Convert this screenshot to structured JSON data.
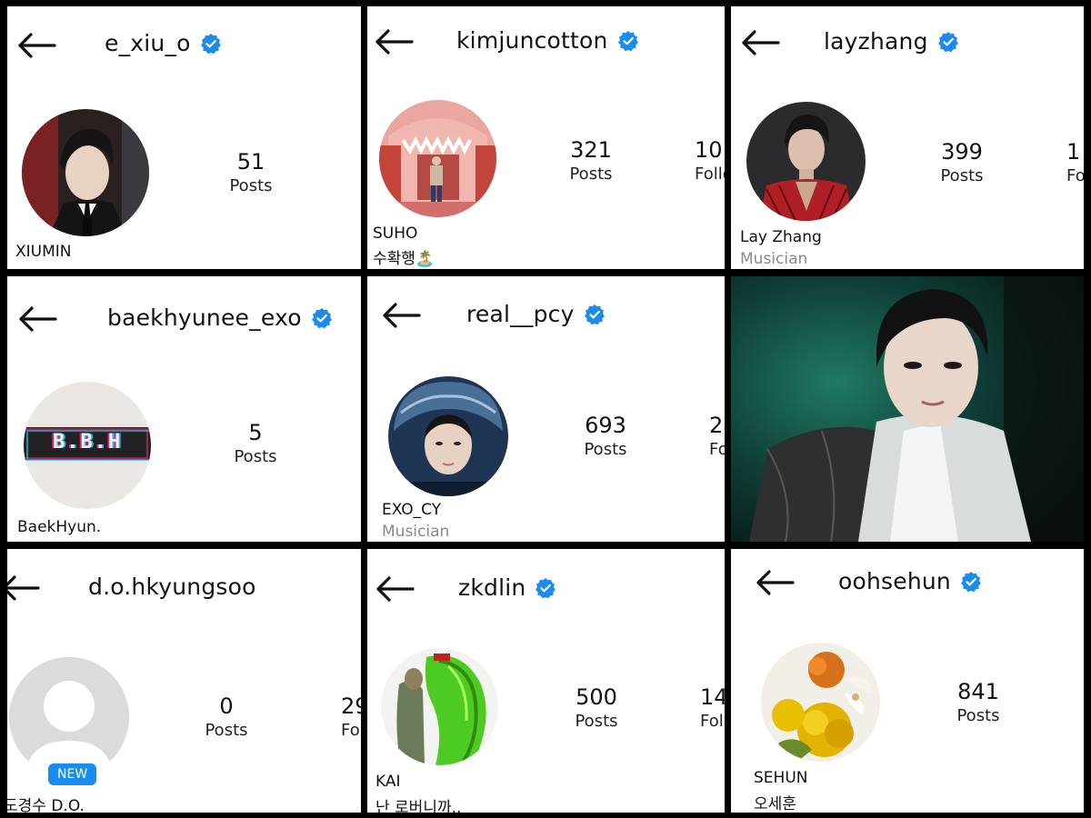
{
  "profiles": {
    "xiumin": {
      "handle": "e_xiu_o",
      "posts": "51",
      "posts_label": "Posts",
      "name": "XIUMIN"
    },
    "suho": {
      "handle": "kimjuncotton",
      "posts": "321",
      "posts_label": "Posts",
      "next_count": "10",
      "next_label": "Follo",
      "name": "SUHO",
      "bio": "수확행🏝️"
    },
    "lay": {
      "handle": "layzhang",
      "posts": "399",
      "posts_label": "Posts",
      "next_count": "1",
      "next_label": "Fo",
      "name": "Lay Zhang",
      "category": "Musician"
    },
    "baekhyun": {
      "handle": "baekhyunee_exo",
      "posts": "5",
      "posts_label": "Posts",
      "name": "BaekHyun.",
      "avatar_text": "B.B.H"
    },
    "chanyeol": {
      "handle": "real__pcy",
      "posts": "693",
      "posts_label": "Posts",
      "next_count": "2",
      "next_label": "Fo",
      "name": "EXO_CY",
      "category": "Musician"
    },
    "dyo": {
      "handle": "d.o.hkyungsoo",
      "posts": "0",
      "posts_label": "Posts",
      "next_count": "29",
      "next_label": "Follo",
      "name": "도경수 D.O.",
      "badge": "NEW"
    },
    "kai": {
      "handle": "zkdlin",
      "posts": "500",
      "posts_label": "Posts",
      "next_count": "14",
      "next_label": "Fol",
      "name": "KAI",
      "bio": "난 로버니까.."
    },
    "sehun": {
      "handle": "oohsehun",
      "posts": "841",
      "posts_label": "Posts",
      "name": "SEHUN",
      "bio": "오세훈"
    }
  },
  "colors": {
    "verified": "#1a8cf0",
    "muted": "#8a8a8a",
    "separator": "#000000"
  },
  "icons": {
    "back": "back-arrow-icon",
    "verified": "verified-badge-icon"
  }
}
